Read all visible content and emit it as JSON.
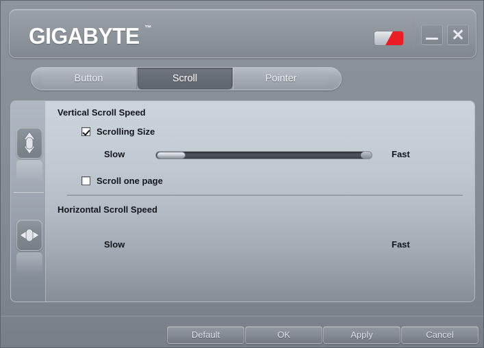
{
  "window": {
    "brand": "GIGABYTE",
    "trademark": "™",
    "flag_colors": {
      "red": "#ec1c24",
      "white": "#e6e9ec"
    },
    "buttons": {
      "minimize": {
        "name": "minimize-button",
        "glyph": "_"
      },
      "close": {
        "name": "close-button",
        "glyph": "✕"
      }
    }
  },
  "tabs": [
    {
      "label": "Button",
      "active": false
    },
    {
      "label": "Scroll",
      "active": true
    },
    {
      "label": "Pointer",
      "active": false
    }
  ],
  "rail": {
    "icons": [
      {
        "name": "vertical-scroll-icon",
        "label": "Vertical Scroll",
        "selected": true
      },
      {
        "name": "horizontal-scroll-icon",
        "label": "Horizontal Scroll",
        "selected": false
      }
    ]
  },
  "sections": {
    "vertical": {
      "title": "Vertical Scroll Speed",
      "scrolling_size": {
        "label": "Scrolling Size",
        "checked": true
      },
      "scroll_one_page": {
        "label": "Scroll one page",
        "checked": false
      },
      "slider": {
        "slow_label": "Slow",
        "fast_label": "Fast",
        "value_percent": 0,
        "visible": true
      }
    },
    "horizontal": {
      "title": "Horizontal Scroll Speed",
      "slider": {
        "slow_label": "Slow",
        "fast_label": "Fast",
        "value_percent": 0,
        "visible": false
      }
    }
  },
  "footer": {
    "default_label": "Default",
    "ok_label": "OK",
    "apply_label": "Apply",
    "cancel_label": "Cancel"
  },
  "theme": {
    "window_bg": "#878e96",
    "panel_top": "#ccd4dd",
    "panel_bottom": "#868e97",
    "accent_red": "#ec1c24",
    "text_dark": "#12161b",
    "text_light": "#dfe3e7"
  }
}
